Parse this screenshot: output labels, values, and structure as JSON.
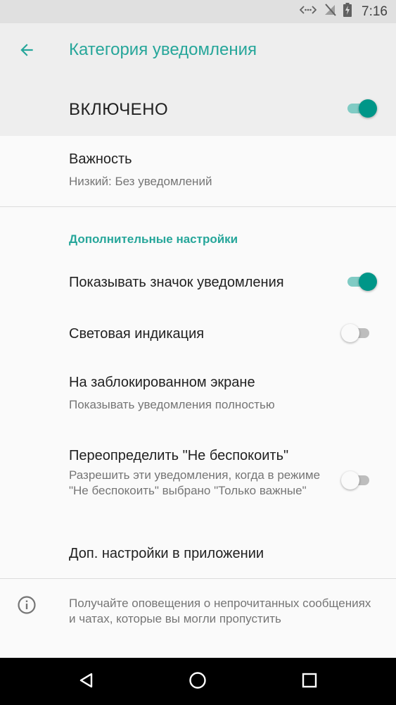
{
  "status_bar": {
    "time": "7:16",
    "icons": [
      "data-sync-icon",
      "no-signal-icon",
      "battery-charging-icon"
    ]
  },
  "app_bar": {
    "title": "Категория уведомления",
    "back_icon": "arrow-back-icon"
  },
  "master": {
    "label": "ВКЛЮЧЕНО",
    "enabled": true
  },
  "importance": {
    "title": "Важность",
    "value": "Низкий: Без уведомлений"
  },
  "advanced": {
    "header": "Дополнительные настройки",
    "show_badge": {
      "title": "Показывать значок уведомления",
      "enabled": true
    },
    "light": {
      "title": "Световая индикация",
      "enabled": false
    },
    "lock_screen": {
      "title": "На заблокированном экране",
      "value": "Показывать уведомления полностью"
    },
    "dnd_override": {
      "title": "Переопределить \"Не беспокоить\"",
      "description": "Разрешить эти уведомления, когда в режиме \"Не беспокоить\" выбрано \"Только важные\"",
      "enabled": false
    },
    "app_settings": {
      "title": "Доп. настройки в приложении"
    }
  },
  "footer": {
    "icon": "info-icon",
    "text": "Получайте оповещения о непрочитанных сообщениях и чатах, которые вы могли пропустить"
  },
  "nav_bar": {
    "buttons": [
      "back-triangle-icon",
      "home-circle-icon",
      "recents-square-icon"
    ]
  },
  "colors": {
    "accent": "#26a69a",
    "switch_on": "#009688",
    "switch_on_track": "#80cbc4"
  }
}
